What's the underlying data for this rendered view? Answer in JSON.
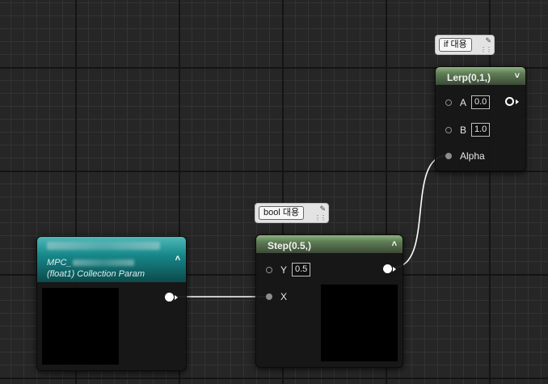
{
  "colors": {
    "grid_bg": "#262626",
    "green_header": "#5f7e55",
    "teal_header": "#17888a",
    "wire": "#ffffff"
  },
  "lerp_node": {
    "title": "Lerp(0,1,)",
    "comment": "if 대용",
    "collapse_icon": "chevron-down-icon",
    "pins": [
      {
        "label": "A",
        "value": "0.0"
      },
      {
        "label": "B",
        "value": "1.0"
      },
      {
        "label": "Alpha"
      }
    ]
  },
  "step_node": {
    "title": "Step(0.5,)",
    "comment": "bool 대용",
    "collapse_icon": "chevron-up-icon",
    "pins": [
      {
        "label": "Y",
        "value": "0.5"
      },
      {
        "label": "X"
      }
    ]
  },
  "mpc_node": {
    "title": "",
    "name_prefix": "MPC_",
    "subtitle": "(float1) Collection Param",
    "collapse_icon": "chevron-up-icon"
  }
}
